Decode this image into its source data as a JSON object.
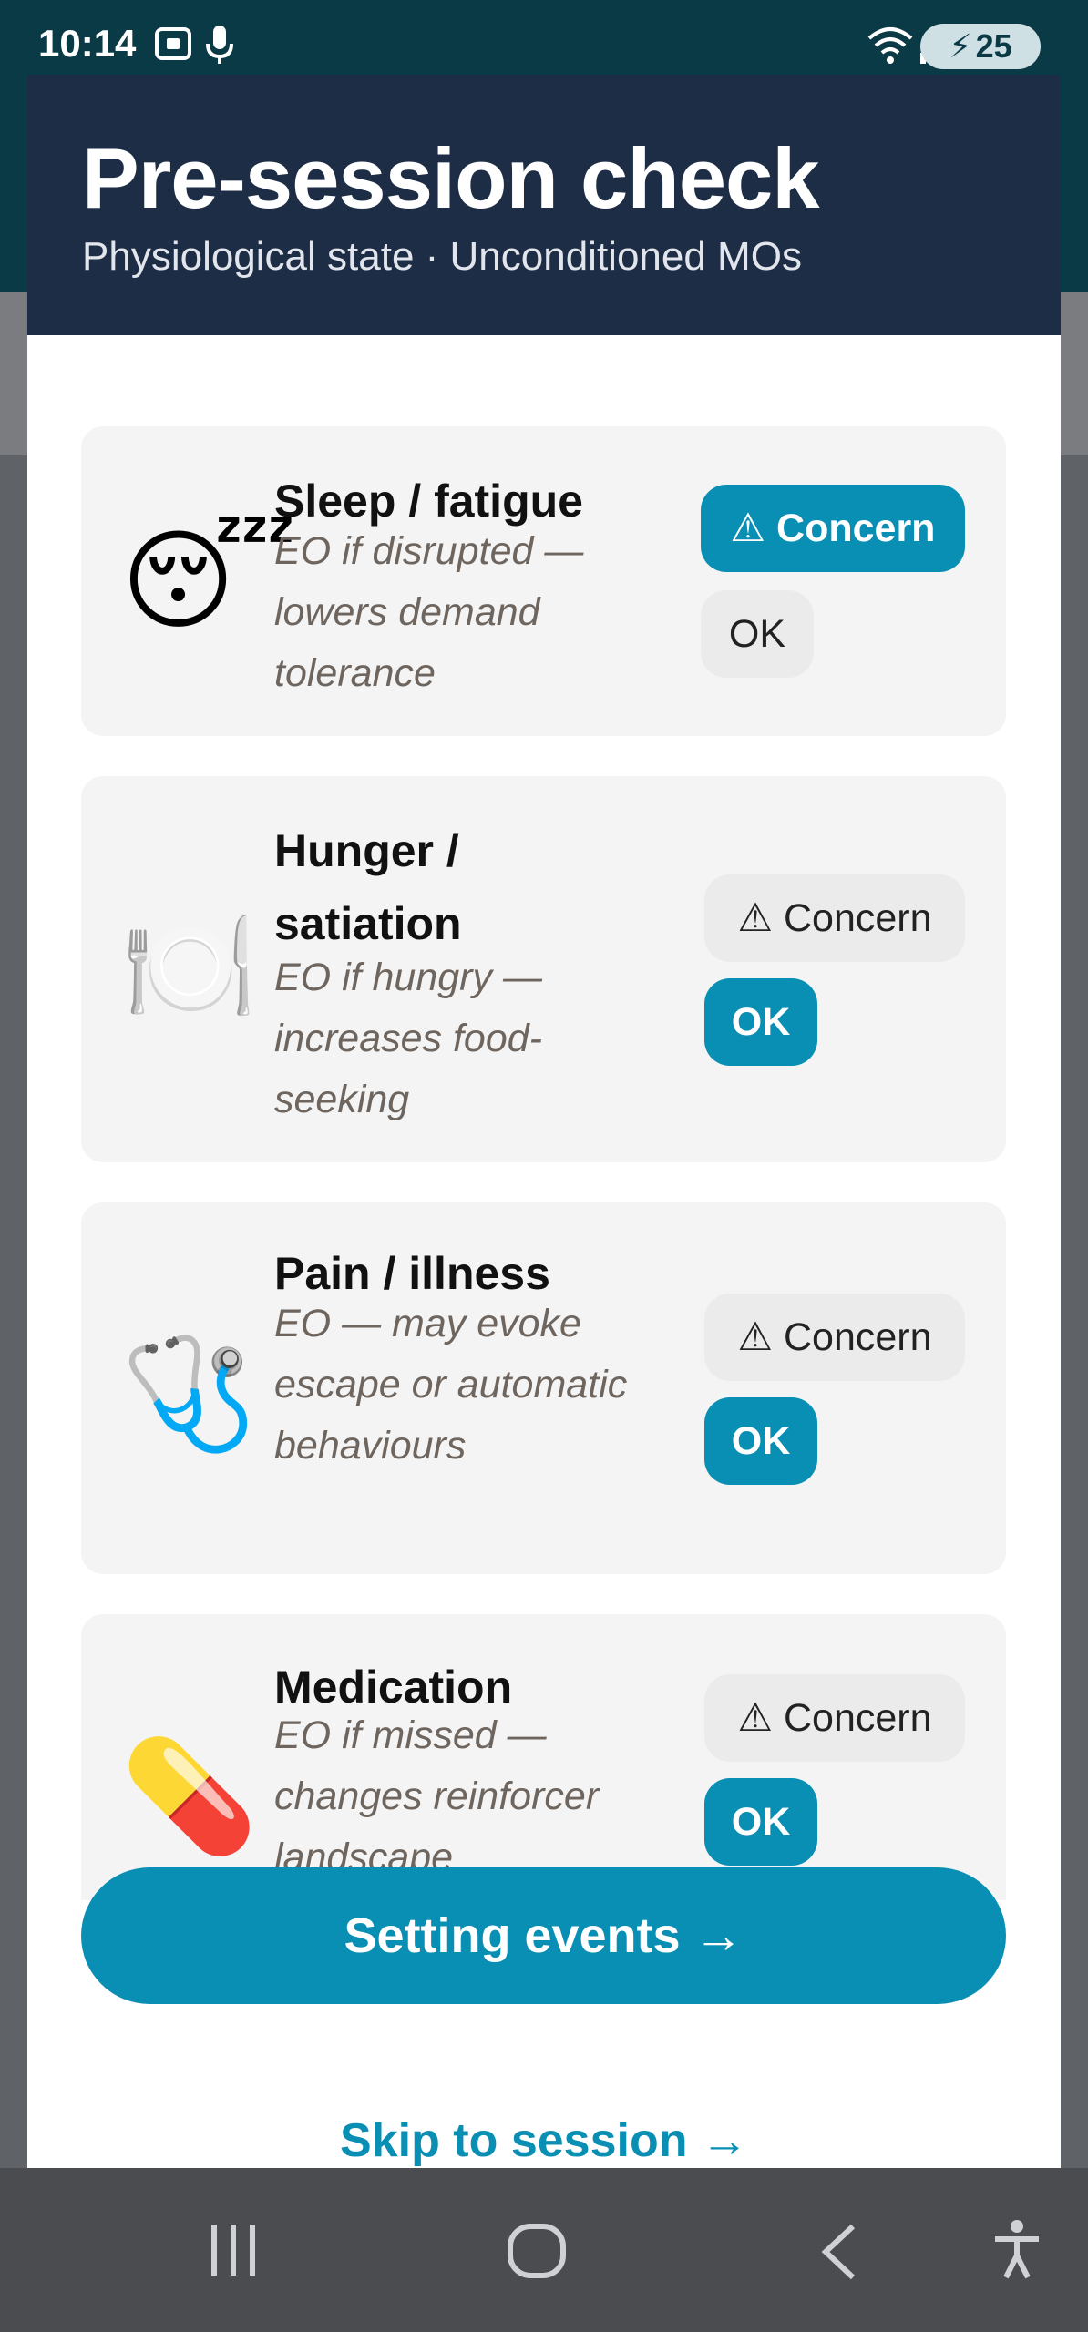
{
  "status_bar": {
    "time": "10:14",
    "battery": "25",
    "icons": [
      "screenshot-icon",
      "mic-icon",
      "wifi-icon",
      "signal-icon",
      "battery-icon"
    ]
  },
  "sheet": {
    "title": "Pre-session check",
    "subtitle": "Physiological state · Unconditioned MOs"
  },
  "items": [
    {
      "emoji": "😴",
      "icon": "sleep-icon",
      "title": "Sleep / fatigue",
      "desc": "EO if disrupted — lowers demand tolerance",
      "concern_label": "⚠ Concern",
      "ok_label": "OK",
      "selected": "concern"
    },
    {
      "emoji": "🍽️",
      "icon": "plate-icon",
      "title": "Hunger / satiation",
      "desc": "EO if hungry — increases food-seeking",
      "concern_label": "⚠ Concern",
      "ok_label": "OK",
      "selected": "ok"
    },
    {
      "emoji": "🩺",
      "icon": "stethoscope-icon",
      "title": "Pain / illness",
      "desc": "EO — may evoke escape or automatic behaviours",
      "concern_label": "⚠ Concern",
      "ok_label": "OK",
      "selected": "ok"
    },
    {
      "emoji": "💊",
      "icon": "pill-icon",
      "title": "Medication",
      "desc": "EO if missed — changes reinforcer landscape",
      "concern_label": "⚠ Concern",
      "ok_label": "OK",
      "selected": "ok"
    }
  ],
  "actions": {
    "primary": "Setting events →",
    "skip": "Skip to session →"
  },
  "colors": {
    "accent": "#0a8fb4",
    "header": "#1e2d46",
    "statusbar": "#0b3a47"
  },
  "nav": [
    "recents-icon",
    "home-icon",
    "back-icon",
    "accessibility-icon"
  ]
}
